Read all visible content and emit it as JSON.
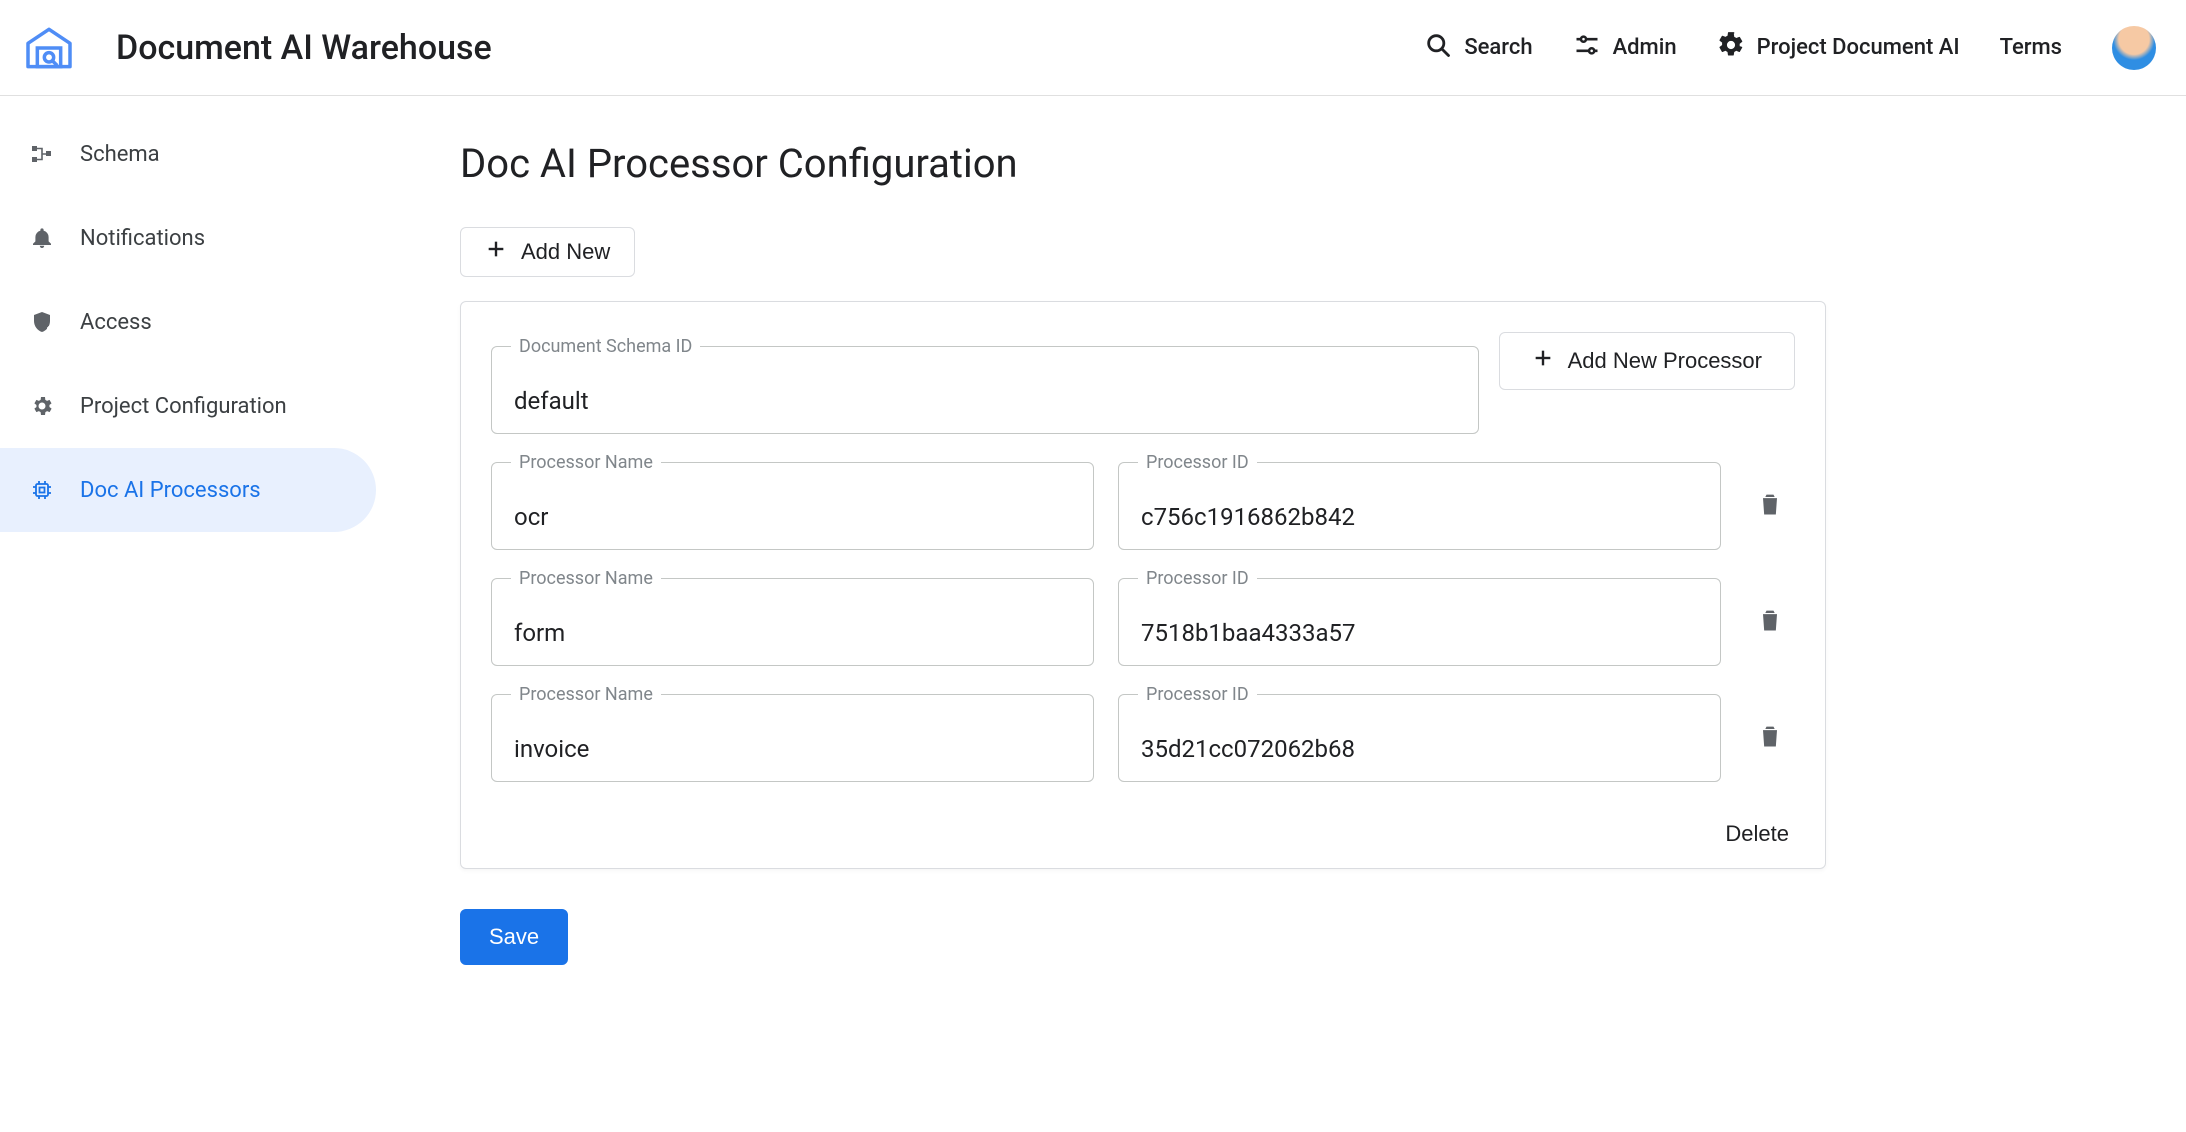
{
  "header": {
    "app_title": "Document AI Warehouse",
    "search_label": "Search",
    "admin_label": "Admin",
    "project_label": "Project Document AI",
    "terms_label": "Terms"
  },
  "sidebar": {
    "items": [
      {
        "label": "Schema"
      },
      {
        "label": "Notifications"
      },
      {
        "label": "Access"
      },
      {
        "label": "Project Configuration"
      },
      {
        "label": "Doc AI Processors"
      }
    ],
    "active_index": 4
  },
  "page": {
    "title": "Doc AI Processor Configuration",
    "add_new_label": "Add New",
    "add_new_processor_label": "Add New Processor",
    "delete_label": "Delete",
    "save_label": "Save",
    "schema_field_label": "Document Schema ID",
    "schema_value": "default",
    "processor_name_label": "Processor Name",
    "processor_id_label": "Processor ID",
    "processors": [
      {
        "name": "ocr",
        "id": "c756c1916862b842"
      },
      {
        "name": "form",
        "id": "7518b1baa4333a57"
      },
      {
        "name": "invoice",
        "id": "35d21cc072062b68"
      }
    ]
  }
}
